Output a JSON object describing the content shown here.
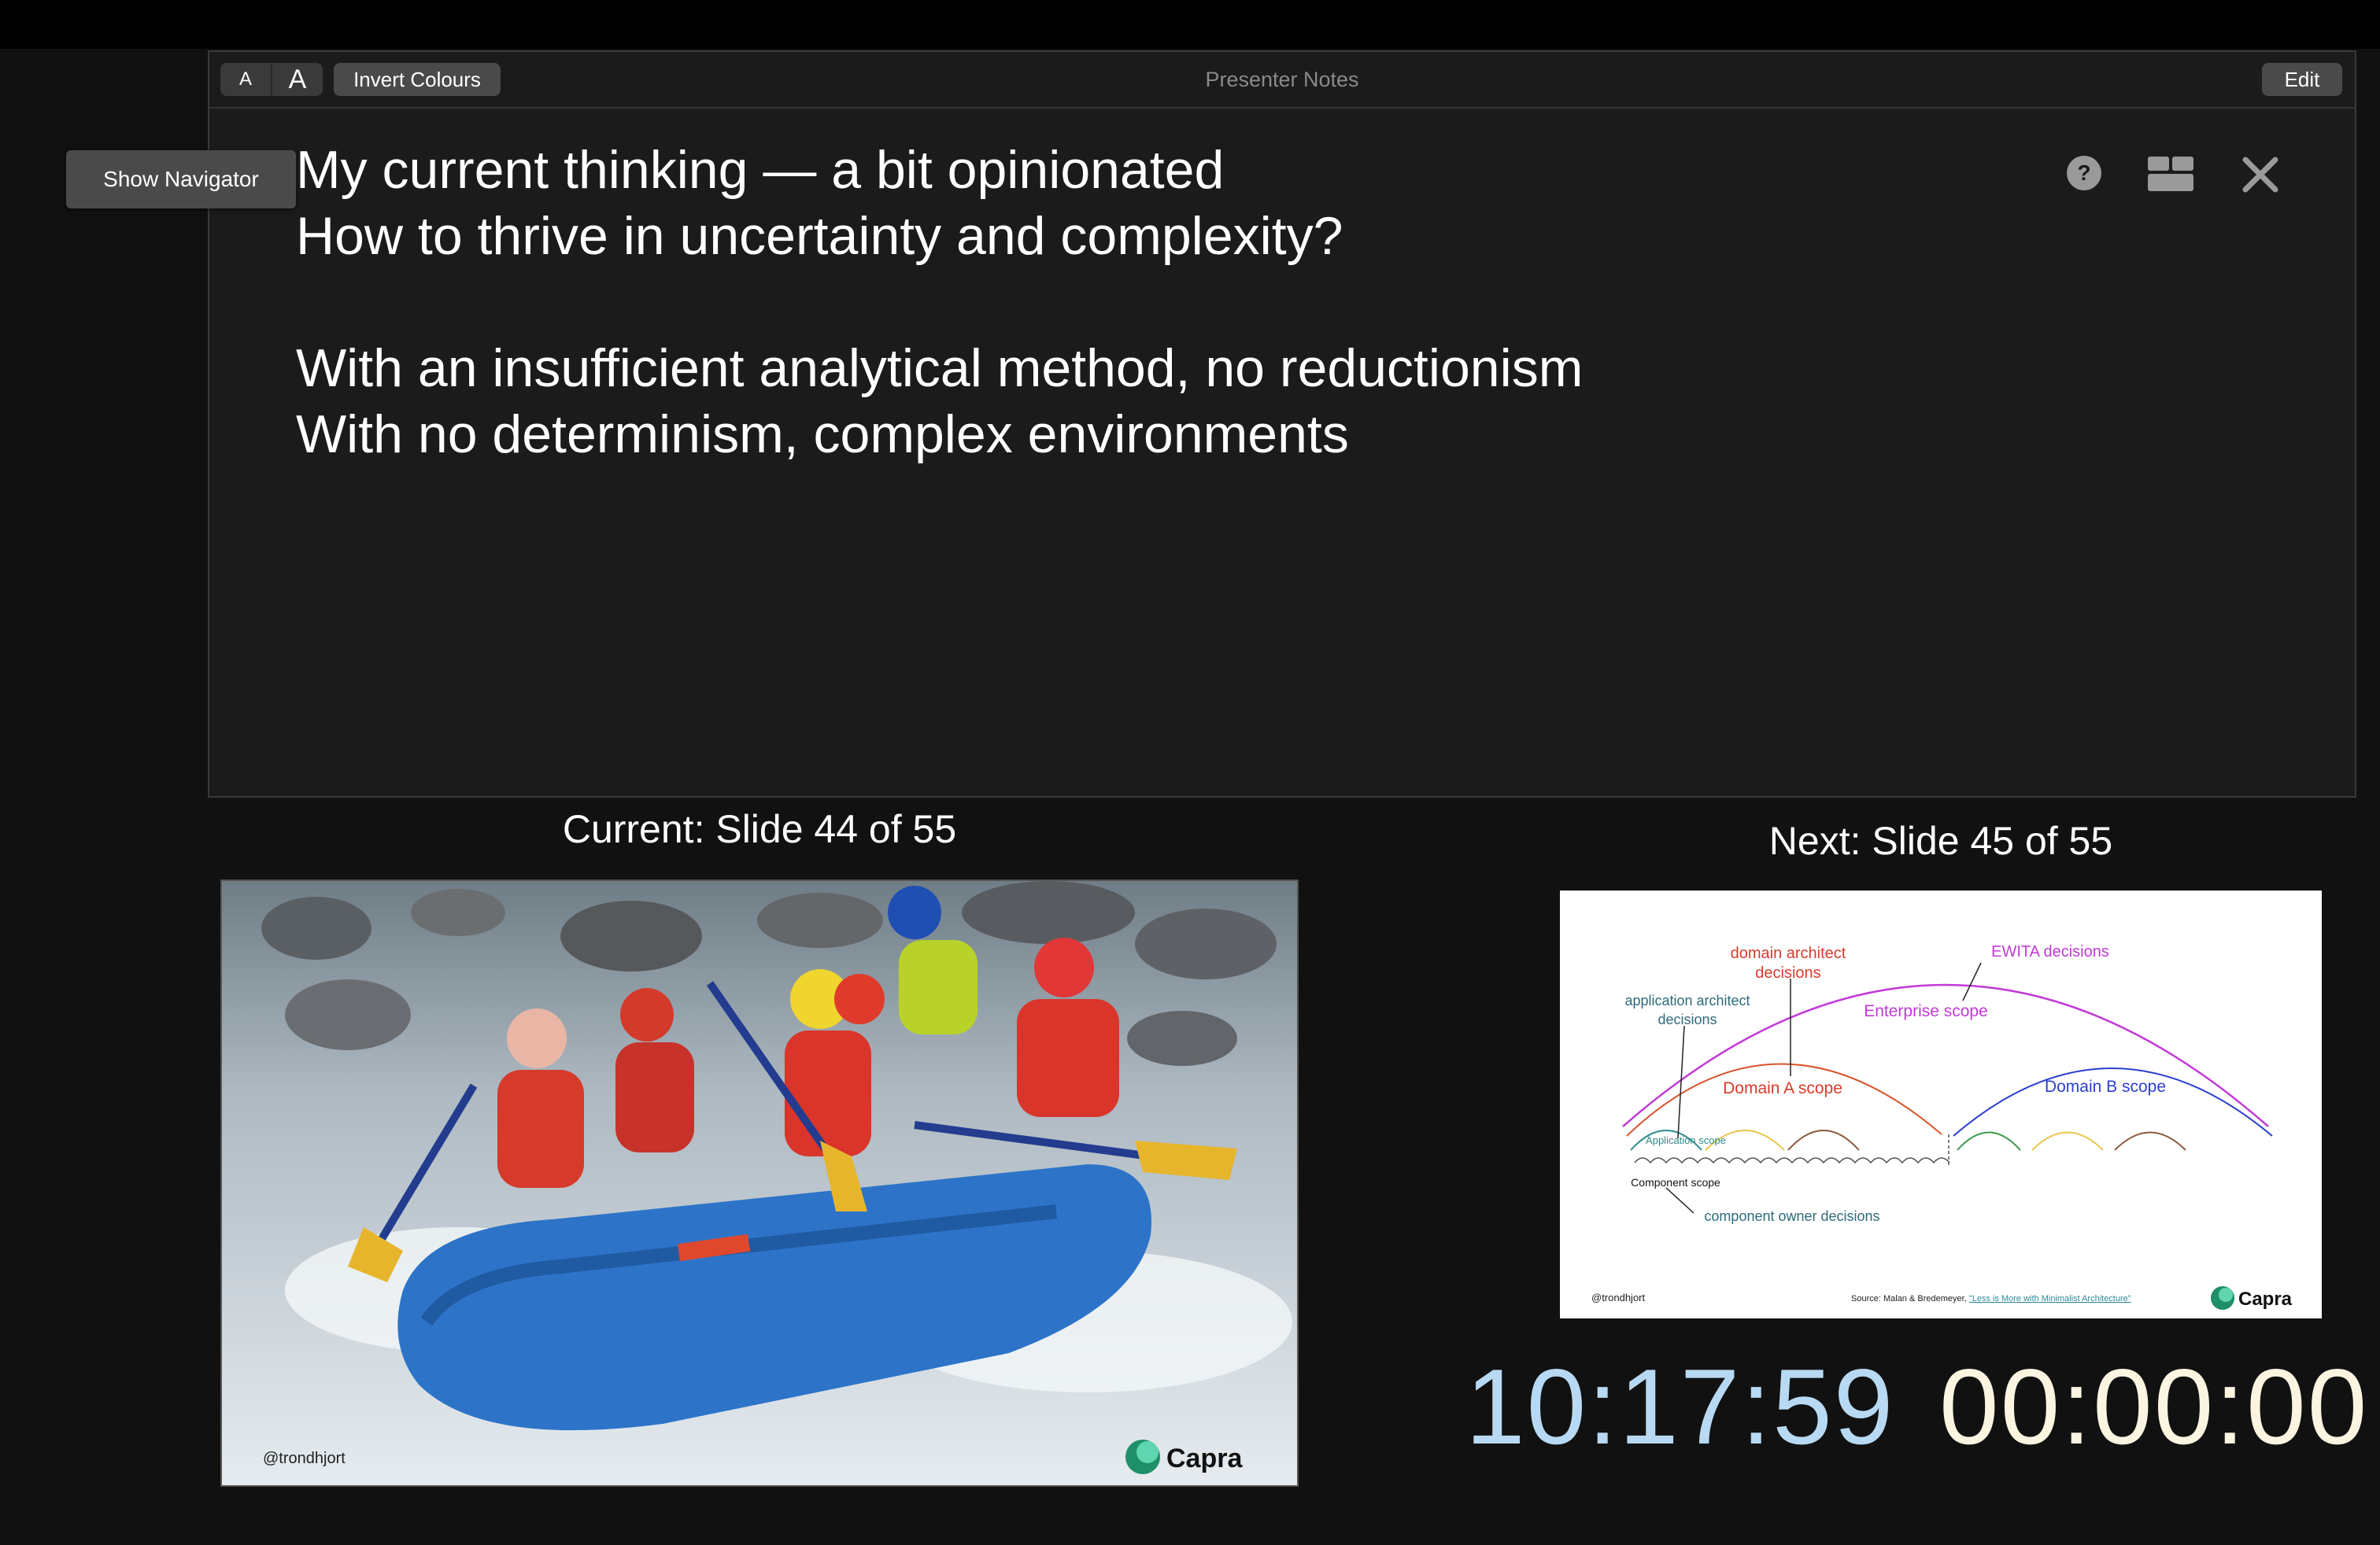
{
  "toolbar": {
    "font_small_label": "A",
    "font_large_label": "A",
    "invert_label": "Invert Colours",
    "title": "Presenter Notes",
    "edit_label": "Edit"
  },
  "navigator": {
    "label": "Show Navigator"
  },
  "icons": {
    "help": "help-icon",
    "layout": "layout-icon",
    "close": "close-icon"
  },
  "notes": {
    "lines": [
      "My current thinking — a bit opinionated",
      "How to thrive in uncertainty and complexity?",
      "",
      "With an insufficient analytical method, no reductionism",
      "With no determinism, complex environments"
    ]
  },
  "current": {
    "label": "Current: Slide 44 of 55",
    "handle": "@trondhjort",
    "logo": "Capra"
  },
  "next": {
    "label": "Next: Slide 45 of 55",
    "diagram": {
      "domain_architect": [
        "domain architect",
        "decisions"
      ],
      "ewita": "EWITA decisions",
      "app_architect": [
        "application architect",
        "decisions"
      ],
      "enterprise_scope": "Enterprise scope",
      "domain_a_scope": "Domain A scope",
      "domain_b_scope": "Domain B scope",
      "application_scope": "Application scope",
      "component_scope": "Component scope",
      "component_owner": "component owner decisions",
      "handle": "@trondhjort",
      "source_prefix": "Source: Malan & Bredemeyer, ",
      "source_link": "\"Less is More with Minimalist Architecture\"",
      "logo": "Capra"
    }
  },
  "clock": {
    "time": "10:17:59",
    "timer": "00:00:00"
  },
  "colors": {
    "clock": "#b7d9f3",
    "timer": "#fbf4e1",
    "red": "#d93a2b",
    "magenta": "#c23ad8",
    "teal": "#2d8a8a",
    "blue": "#2b3fd0"
  }
}
